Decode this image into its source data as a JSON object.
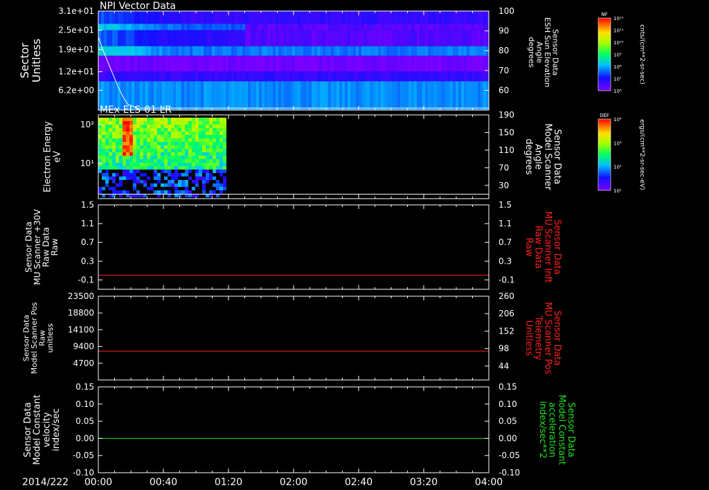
{
  "date_label": "2014/222",
  "x_tick_labels": [
    "00:00",
    "00:40",
    "01:20",
    "02:00",
    "02:40",
    "03:20",
    "04:00"
  ],
  "colors": {
    "background": "#000000",
    "frame": "#ffffff",
    "red": "#ff2020",
    "green": "#20e020"
  },
  "chart_data": [
    {
      "type": "heatmap",
      "title": "NPI Vector Data",
      "ylabel": [
        "Sector",
        "Unitless"
      ],
      "y_tick_labels": [
        "3.1e+01",
        "2.5e+01",
        "1.9e+01",
        "1.2e+01",
        "6.2e+00"
      ],
      "y_ticks": [
        31,
        25,
        19,
        12,
        6.2
      ],
      "ylim": [
        0,
        31
      ],
      "right_ylabel": [
        "Sensor Data",
        "ESH Sun Elevation",
        "Angle",
        "degrees"
      ],
      "right_y_tick_labels": [
        "100",
        "90",
        "80",
        "70",
        "60"
      ],
      "right_ylim": [
        50,
        100
      ],
      "overlay_line": {
        "x_hours": [
          0.0,
          0.05,
          0.1,
          0.15,
          0.2,
          0.25,
          0.3,
          0.4,
          0.6,
          1.0,
          4.0
        ],
        "y_deg": [
          87,
          80,
          74,
          68,
          62,
          57,
          53,
          51,
          51,
          51,
          51
        ]
      },
      "colorbar": {
        "label": "NF",
        "units": "cnts/(cm**2-sr-sec)",
        "tick_labels": [
          "10¹²",
          "10¹¹",
          "10¹⁰",
          "10⁹",
          "10⁸",
          "10⁷",
          "10⁶"
        ]
      },
      "bands": [
        {
          "y": [
            27,
            31
          ],
          "level": 0.12,
          "xmax_hours": 4.0
        },
        {
          "y": [
            25,
            27
          ],
          "level": 0.25,
          "xmax_hours": 4.0
        },
        {
          "y": [
            20,
            25
          ],
          "level": 0.14,
          "xmax_hours": 4.0
        },
        {
          "y": [
            17,
            20
          ],
          "level": 0.28,
          "xmax_hours": 4.0
        },
        {
          "y": [
            12,
            17
          ],
          "level": 0.02,
          "xmax_hours": 4.0
        },
        {
          "y": [
            9,
            12
          ],
          "level": 0.12,
          "xmax_hours": 4.0
        },
        {
          "y": [
            0,
            9
          ],
          "level": 0.3,
          "xmax_hours": 4.0
        }
      ]
    },
    {
      "type": "heatmap",
      "title": "MEx ELS-01 LR",
      "ylabel": [
        "Electron Energy",
        "eV"
      ],
      "y_tick_labels": [
        "10²",
        "10¹"
      ],
      "y_ticks": [
        100,
        10
      ],
      "ylim": [
        1.2,
        180
      ],
      "yscale": "log",
      "right_ylabel": [
        "Sensor Data",
        "Model Scanner",
        "Angle",
        "degrees"
      ],
      "right_y_tick_labels": [
        "190",
        "150",
        "110",
        "70",
        "30"
      ],
      "right_ylim": [
        0,
        190
      ],
      "overlay_line": {
        "x_hours": [
          0.0,
          4.0
        ],
        "y_deg": [
          10,
          10
        ]
      },
      "data_xmax_hours": 1.3,
      "colorbar": {
        "label": "DEF",
        "units": "ergs/(cm**2-sr-sec-eV)",
        "tick_labels": [
          "10⁴",
          "10³",
          "10²",
          "10¹"
        ]
      }
    },
    {
      "type": "line",
      "ylabel": [
        "Sensor Data",
        "MU Scanner +30V",
        "Raw Data",
        "Raw"
      ],
      "y_tick_labels": [
        "1.5",
        "1.1",
        "0.7",
        "0.3",
        "-0.1"
      ],
      "ylim": [
        -0.3,
        1.5
      ],
      "right_ylabel": [
        "Sensor Data",
        "MU Scanner Inft",
        "Raw Data",
        "Raw"
      ],
      "right_y_tick_labels": [
        "1.5",
        "1.1",
        "0.7",
        "0.3",
        "-0.1"
      ],
      "series": [
        {
          "x_hours": [
            0,
            4
          ],
          "values": [
            0.0,
            0.0
          ],
          "color": "#ff2020"
        }
      ]
    },
    {
      "type": "line",
      "ylabel": [
        "Sensor Data",
        "Model Scanner Pos",
        "Raw",
        "unitless"
      ],
      "y_tick_labels": [
        "23500",
        "18800",
        "14100",
        "9400",
        "4700"
      ],
      "ylim": [
        0,
        23500
      ],
      "right_ylabel": [
        "Sensor Data",
        "MU Scanner Pos",
        "Telemetry",
        "Unitless"
      ],
      "right_y_tick_labels": [
        "260",
        "206",
        "152",
        "98",
        "44"
      ],
      "series": [
        {
          "x_hours": [
            0,
            4
          ],
          "values": [
            8100,
            8100
          ],
          "color": "#ff2020"
        }
      ]
    },
    {
      "type": "line",
      "ylabel": [
        "Sensor Data",
        "Model Constant",
        "velocity",
        "index/sec"
      ],
      "y_tick_labels": [
        "0.15",
        "0.10",
        "0.05",
        "0.00",
        "-0.05",
        "-0.10"
      ],
      "ylim": [
        -0.1,
        0.15
      ],
      "right_ylabel": [
        "Sensor Data",
        "Model Constant",
        "acceleration",
        "index/sec**2"
      ],
      "right_y_tick_labels": [
        "0.15",
        "0.10",
        "0.05",
        "0.00",
        "-0.05",
        "-0.10"
      ],
      "series": [
        {
          "x_hours": [
            0,
            4
          ],
          "values": [
            0.0,
            0.0
          ],
          "color": "#20e020"
        }
      ]
    }
  ]
}
